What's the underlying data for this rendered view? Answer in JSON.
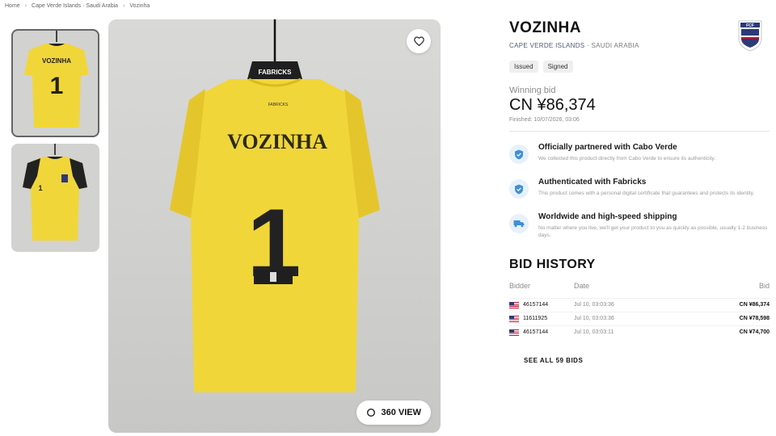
{
  "breadcrumb": [
    "Home",
    "Cape Verde Islands · Saudi Arabia",
    "Vozinha"
  ],
  "product": {
    "name": "VOZINHA",
    "team_home": "CAPE VERDE ISLANDS",
    "team_away": "SAUDI ARABIA",
    "tags": [
      "Issued",
      "Signed"
    ],
    "shirt_name": "VOZINHA",
    "shirt_number": "1",
    "collar_label": "FABRICKS",
    "federation_logo_text": "FCF"
  },
  "auction": {
    "winning_label": "Winning bid",
    "price": "CN ¥86,374",
    "finished": "Finished: 10/07/2026, 03:06"
  },
  "features": [
    {
      "icon": "shield-check-icon",
      "title": "Officially partnered with Cabo Verde",
      "desc": "We collected this product directly from Cabo Verde to ensure its authenticity."
    },
    {
      "icon": "shield-check-icon",
      "title": "Authenticated with Fabricks",
      "desc": "This product comes with a personal digital certificate that guarantees and protects its identity."
    },
    {
      "icon": "truck-icon",
      "title": "Worldwide and high-speed shipping",
      "desc": "No matter where you live, we'll get your product to you as quickly as possible, usually 1-2 business days."
    }
  ],
  "bid_history": {
    "title": "BID HISTORY",
    "headers": {
      "bidder": "Bidder",
      "date": "Date",
      "bid": "Bid"
    },
    "rows": [
      {
        "bidder": "46157144",
        "date": "Jul 10, 03:03:36",
        "bid": "CN ¥86,374"
      },
      {
        "bidder": "11611925",
        "date": "Jul 10, 03:03:36",
        "bid": "CN ¥78,598"
      },
      {
        "bidder": "46157144",
        "date": "Jul 10, 03:03:11",
        "bid": "CN ¥74,700"
      }
    ],
    "see_all": "SEE ALL 59 BIDS"
  },
  "media": {
    "view_360_label": "360 VIEW"
  },
  "colors": {
    "jersey": "#f1d63a",
    "jersey_shadow": "#d9bb20",
    "accent_blue": "#3f8fd8",
    "flag_red": "#c8102e",
    "flag_blue": "#2b3a78"
  }
}
